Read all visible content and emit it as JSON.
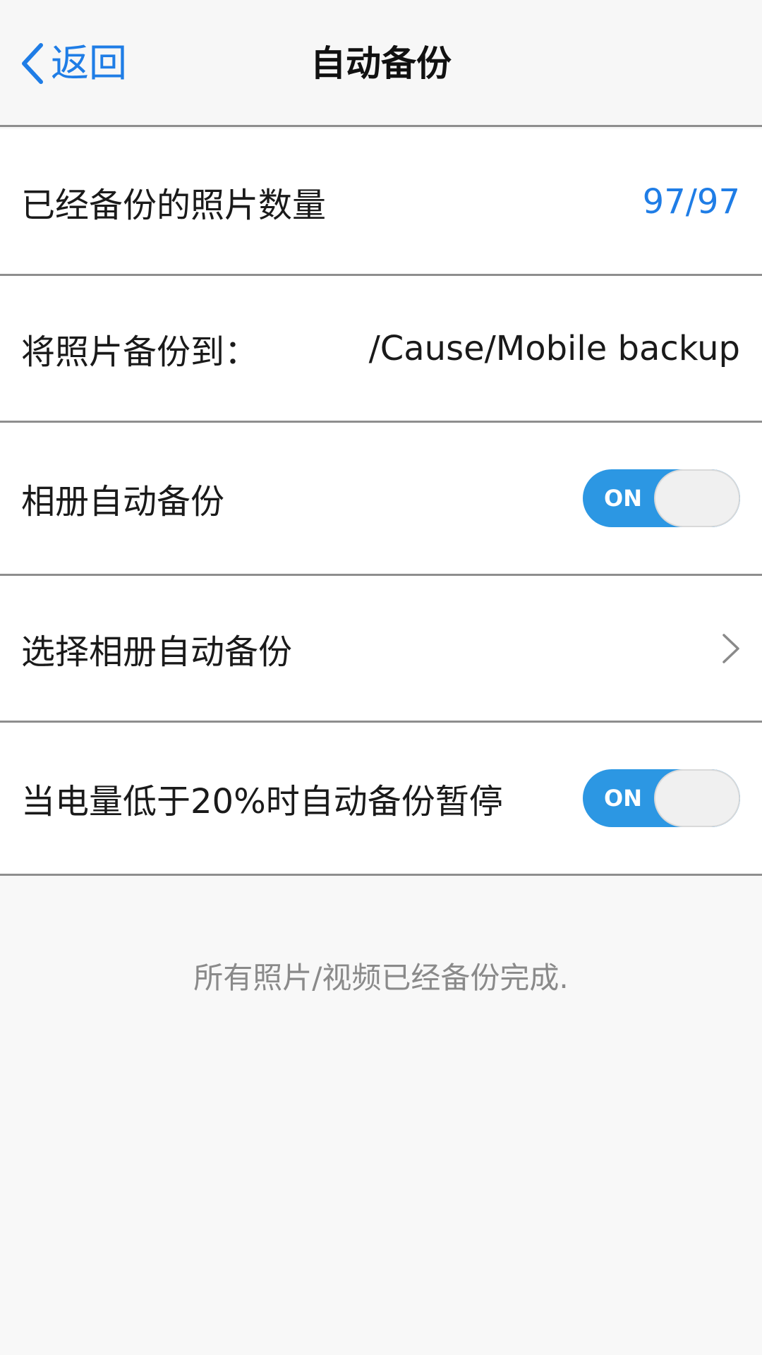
{
  "header": {
    "back_label": "返回",
    "title": "自动备份"
  },
  "rows": [
    {
      "label": "已经备份的照片数量",
      "value": "97/97"
    },
    {
      "label": "将照片备份到：",
      "value": "/Cause/Mobile backup"
    },
    {
      "label": "相册自动备份",
      "toggle": "ON",
      "state": "on"
    },
    {
      "label": "选择相册自动备份"
    },
    {
      "label": "当电量低于20%时自动备份暂停",
      "toggle": "ON",
      "state": "on"
    }
  ],
  "footer": {
    "note": "所有照片/视频已经备份完成."
  },
  "colors": {
    "accent": "#1f7de6",
    "toggle_on": "#2c97e3",
    "divider": "#8e8e8e",
    "background": "#f8f8f8"
  },
  "icons": {
    "back": "chevron-left-icon",
    "row_arrow": "chevron-right-icon"
  }
}
